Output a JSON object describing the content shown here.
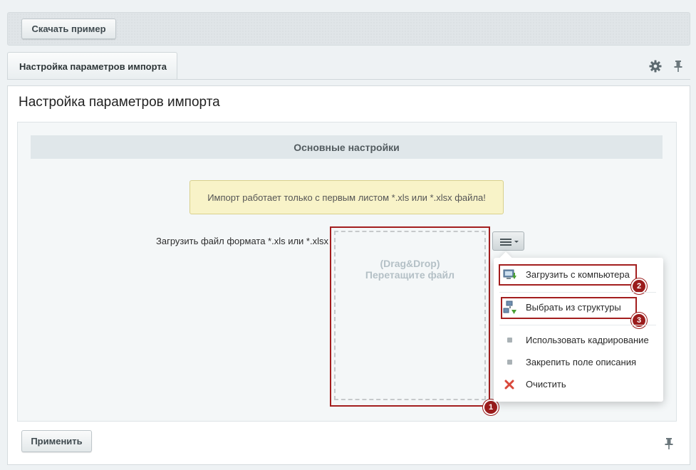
{
  "toolbar": {
    "download_label": "Скачать пример"
  },
  "tab": {
    "label": "Настройка параметров импорта"
  },
  "page": {
    "title": "Настройка параметров импорта"
  },
  "section": {
    "title": "Основные настройки"
  },
  "notice": {
    "text": "Импорт работает только с первым листом *.xls или *.xlsx файла!"
  },
  "field": {
    "label": "Загрузить файл формата *.xls или *.xlsx"
  },
  "dropzone": {
    "line1": "(Drag&Drop)",
    "line2": "Перетащите файл"
  },
  "menu": {
    "items": [
      {
        "label": "Загрузить с компьютера",
        "icon": "computer-upload-icon"
      },
      {
        "label": "Выбрать из структуры",
        "icon": "structure-icon"
      },
      {
        "label": "Использовать кадрирование",
        "icon": "bullet-icon"
      },
      {
        "label": "Закрепить поле описания",
        "icon": "bullet-icon"
      },
      {
        "label": "Очистить",
        "icon": "clear-x-icon"
      }
    ]
  },
  "markers": [
    "1",
    "2",
    "3"
  ],
  "footer": {
    "apply_label": "Применить"
  },
  "colors": {
    "highlight": "#a31e1e",
    "notice_bg": "#f8f3c8",
    "section_bg": "#e0e7ea"
  }
}
